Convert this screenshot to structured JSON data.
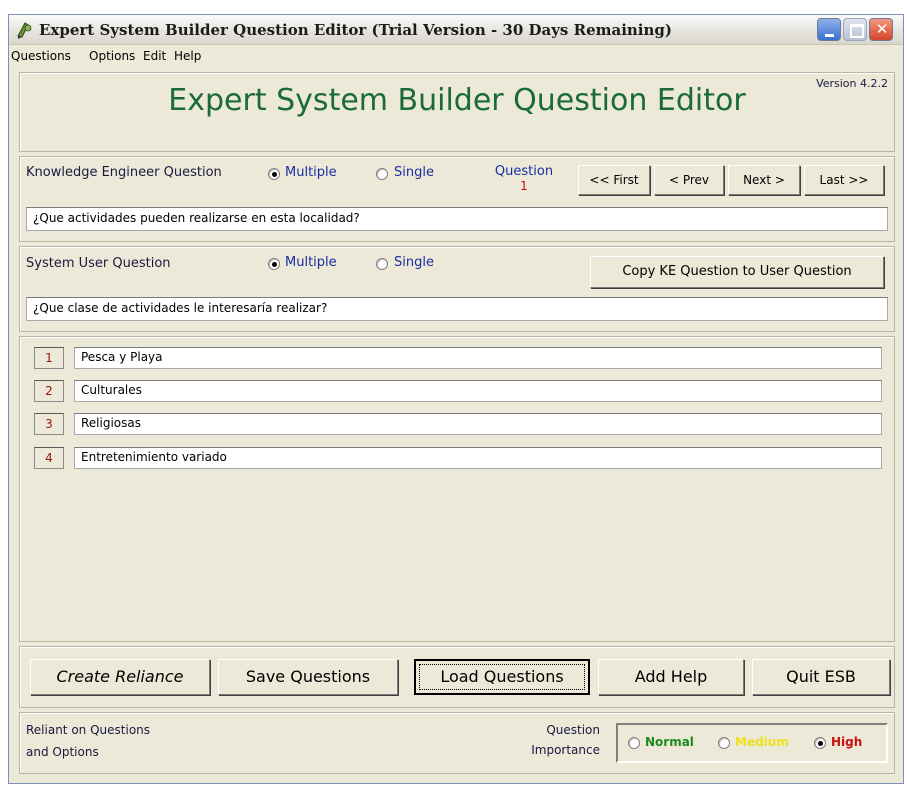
{
  "window": {
    "title": "Expert System Builder Question Editor (Trial Version - 30 Days Remaining)"
  },
  "menu": [
    "Questions",
    "Options",
    "Edit",
    "Help"
  ],
  "header": {
    "title": "Expert System Builder Question Editor",
    "version": "Version 4.2.2"
  },
  "ke": {
    "label": "Knowledge Engineer Question",
    "multiple": "Multiple",
    "single": "Single",
    "selected": "Multiple",
    "question_label": "Question",
    "question_number": "1",
    "nav": [
      "<< First",
      "< Prev",
      "Next >",
      "Last >>"
    ],
    "text": "¿Que actividades pueden realizarse en esta localidad?"
  },
  "user": {
    "label": "System User Question",
    "multiple": "Multiple",
    "single": "Single",
    "selected": "Multiple",
    "copy_button": "Copy KE Question to User Question",
    "text": "¿Que clase de actividades le interesaría realizar?"
  },
  "options": [
    {
      "num": "1",
      "text": "Pesca y Playa"
    },
    {
      "num": "2",
      "text": "Culturales"
    },
    {
      "num": "3",
      "text": "Religiosas"
    },
    {
      "num": "4",
      "text": "Entretenimiento variado"
    }
  ],
  "buttons": {
    "create": "Create Reliance",
    "save": "Save Questions",
    "load": "Load Questions",
    "help": "Add Help",
    "quit": "Quit ESB"
  },
  "footer": {
    "reliant_line1": "Reliant on Questions",
    "reliant_line2": "and Options",
    "importance_line1": "Question",
    "importance_line2": "Importance",
    "normal": "Normal",
    "medium": "Medium",
    "high": "High",
    "selected": "High",
    "colors": {
      "normal": "#1e8a1e",
      "medium": "#f0e020",
      "high": "#cc1010"
    }
  },
  "colors": {
    "header_title": "#1a6a3a",
    "question_number": "#cc1010",
    "text_blue": "#1a2ea0"
  }
}
